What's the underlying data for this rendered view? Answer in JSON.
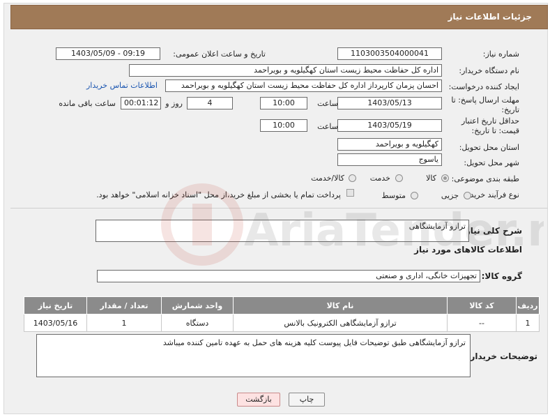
{
  "header": {
    "title": "جزئیات اطلاعات نیاز"
  },
  "fields": {
    "need_number_label": "شماره نیاز:",
    "need_number": "1103003504000041",
    "announce_label": "تاریخ و ساعت اعلان عمومی:",
    "announce_value": "1403/05/09 - 09:19",
    "buyer_org_label": "نام دستگاه خریدار:",
    "buyer_org": "اداره کل حفاظت محیط زیست استان کهگیلویه و بویراحمد",
    "requester_label": "ایجاد کننده درخواست:",
    "requester": "احسان پزمان کارپرداز اداره کل حفاظت محیط زیست استان کهگیلویه و بویراحمد",
    "contact_link": "اطلاعات تماس خریدار",
    "deadline_label": "مهلت ارسال پاسخ: تا تاریخ:",
    "deadline_date": "1403/05/13",
    "time_label": "ساعت",
    "deadline_time": "10:00",
    "days_value": "4",
    "days_label": "روز و",
    "remaining_value": "00:01:12",
    "remaining_label": "ساعت باقی مانده",
    "validity_label": "حداقل تاریخ اعتبار قیمت: تا تاریخ:",
    "validity_date": "1403/05/19",
    "validity_time": "10:00",
    "province_label": "استان محل تحویل:",
    "province": "کهگیلویه و بویراحمد",
    "city_label": "شهر محل تحویل:",
    "city": "یاسوج",
    "category_label": "طبقه بندی موضوعی:",
    "category_options": [
      "کالا",
      "خدمت",
      "کالا/خدمت"
    ],
    "process_label": "نوع فرآیند خرید :",
    "process_options": [
      "جزیی",
      "متوسط"
    ],
    "payment_note": "پرداخت تمام یا بخشی از مبلغ خرید،از محل \"اسناد خزانه اسلامی\" خواهد بود.",
    "desc_label": "شرح کلی نیاز:",
    "desc_value": "ترازو آزمایشگاهی",
    "goods_info_title": "اطلاعات کالاهای مورد نیاز",
    "goods_group_label": "گروه کالا:",
    "goods_group": "تجهیزات خانگی، اداری و صنعتی",
    "buyer_notes_label": "توضیحات خریدار:",
    "buyer_notes": "ترازو آزمایشگاهی طبق توضیحات فایل پیوست کلیه هزینه های حمل به عهده تامین کننده میباشد"
  },
  "table": {
    "headers": [
      "ردیف",
      "کد کالا",
      "نام کالا",
      "واحد شمارش",
      "تعداد / مقدار",
      "تاریخ نیاز"
    ],
    "rows": [
      [
        "1",
        "--",
        "ترازو آزمایشگاهی الکترونیک بالانس",
        "دستگاه",
        "1",
        "1403/05/16"
      ]
    ]
  },
  "buttons": {
    "print": "چاپ",
    "back": "بازگشت"
  },
  "watermark": {
    "text": "AriaTender.net"
  },
  "colors": {
    "header": "#a07a57",
    "table_header": "#8b8b8b",
    "link": "#1a55b0"
  }
}
